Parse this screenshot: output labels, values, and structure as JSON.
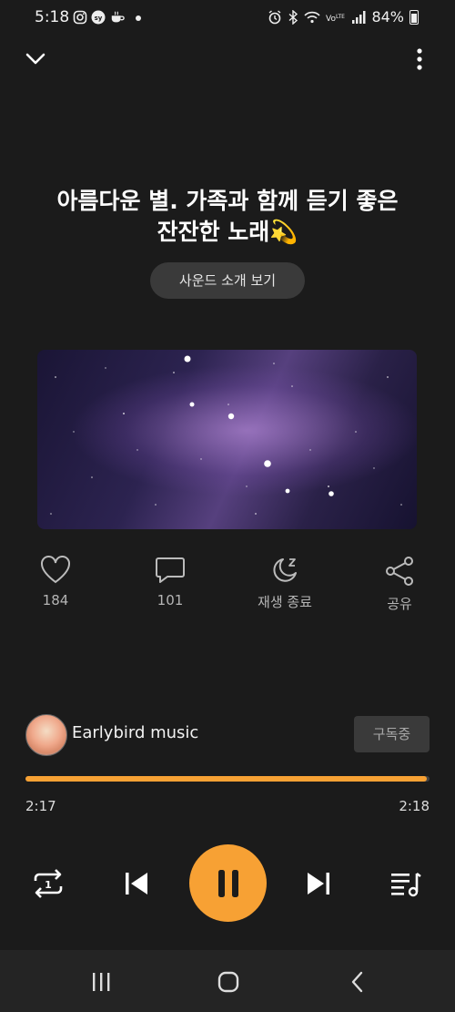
{
  "status_bar": {
    "time": "5:18",
    "battery": "84%"
  },
  "track": {
    "title_line1": "아름다운 별. 가족과 함께 듣기 좋은",
    "title_line2": "잔잔한 노래💫",
    "intro_button": "사운드 소개 보기"
  },
  "actions": {
    "like_count": "184",
    "comment_count": "101",
    "sleep_timer": "재생 종료",
    "share": "공유"
  },
  "channel": {
    "name": "Earlybird music",
    "subscribe_state": "구독중"
  },
  "playback": {
    "elapsed": "2:17",
    "total": "2:18",
    "progress_fraction": 0.993
  },
  "colors": {
    "accent": "#f7a134",
    "background": "#1b1b1b"
  }
}
